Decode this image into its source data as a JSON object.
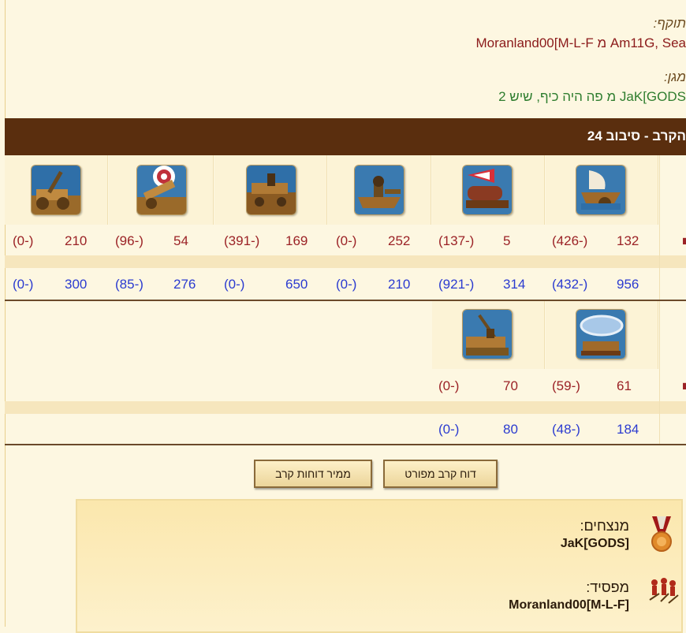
{
  "attacker": {
    "label": "תוקף:",
    "text": "Am11G, Sea מ Moranland00[M-L-F"
  },
  "defender": {
    "label": "מגן:",
    "text": "JaK[GODS מ פה היה כיף, שיש 2"
  },
  "battle_title": "הקרב - סיבוב 24",
  "row1_units": [
    {
      "name": "catapult",
      "attacker_count": "210",
      "attacker_loss": "(0-)",
      "defender_count": "300",
      "defender_loss": "(0-)"
    },
    {
      "name": "ballista",
      "attacker_count": "54",
      "attacker_loss": "(96-)",
      "defender_count": "276",
      "defender_loss": "(85-)"
    },
    {
      "name": "mortar-ship",
      "attacker_count": "169",
      "attacker_loss": "(391-)",
      "defender_count": "650",
      "defender_loss": "(0-)"
    },
    {
      "name": "ram-ship",
      "attacker_count": "252",
      "attacker_loss": "(0-)",
      "defender_count": "210",
      "defender_loss": "(0-)"
    },
    {
      "name": "fire-ship",
      "attacker_count": "5",
      "attacker_loss": "(137-)",
      "defender_count": "314",
      "defender_loss": "(921-)"
    },
    {
      "name": "paddle-ship",
      "attacker_count": "132",
      "attacker_loss": "(426-)",
      "defender_count": "956",
      "defender_loss": "(432-)"
    }
  ],
  "row2_units": [
    {
      "name": "crane-ship",
      "attacker_count": "70",
      "attacker_loss": "(0-)",
      "defender_count": "80",
      "defender_loss": "(0-)"
    },
    {
      "name": "balloon-carrier",
      "attacker_count": "61",
      "attacker_loss": "(59-)",
      "defender_count": "184",
      "defender_loss": "(48-)"
    }
  ],
  "buttons": {
    "detailed_report": "דוח קרב מפורט",
    "convert_reports": "ממיר דוחות קרב"
  },
  "result": {
    "winners_label": "מנצחים:",
    "winners_name": "JaK[GODS]",
    "loser_label": "מפסיד:",
    "loser_name": "Moranland00[M-L-F]"
  },
  "colors": {
    "title_bar": "#5a2e0e",
    "attacker_numbers": "#9b2226",
    "defender_numbers": "#2b3bd0",
    "attacker_name": "#8b1a1a",
    "defender_name": "#2e7d2e"
  }
}
